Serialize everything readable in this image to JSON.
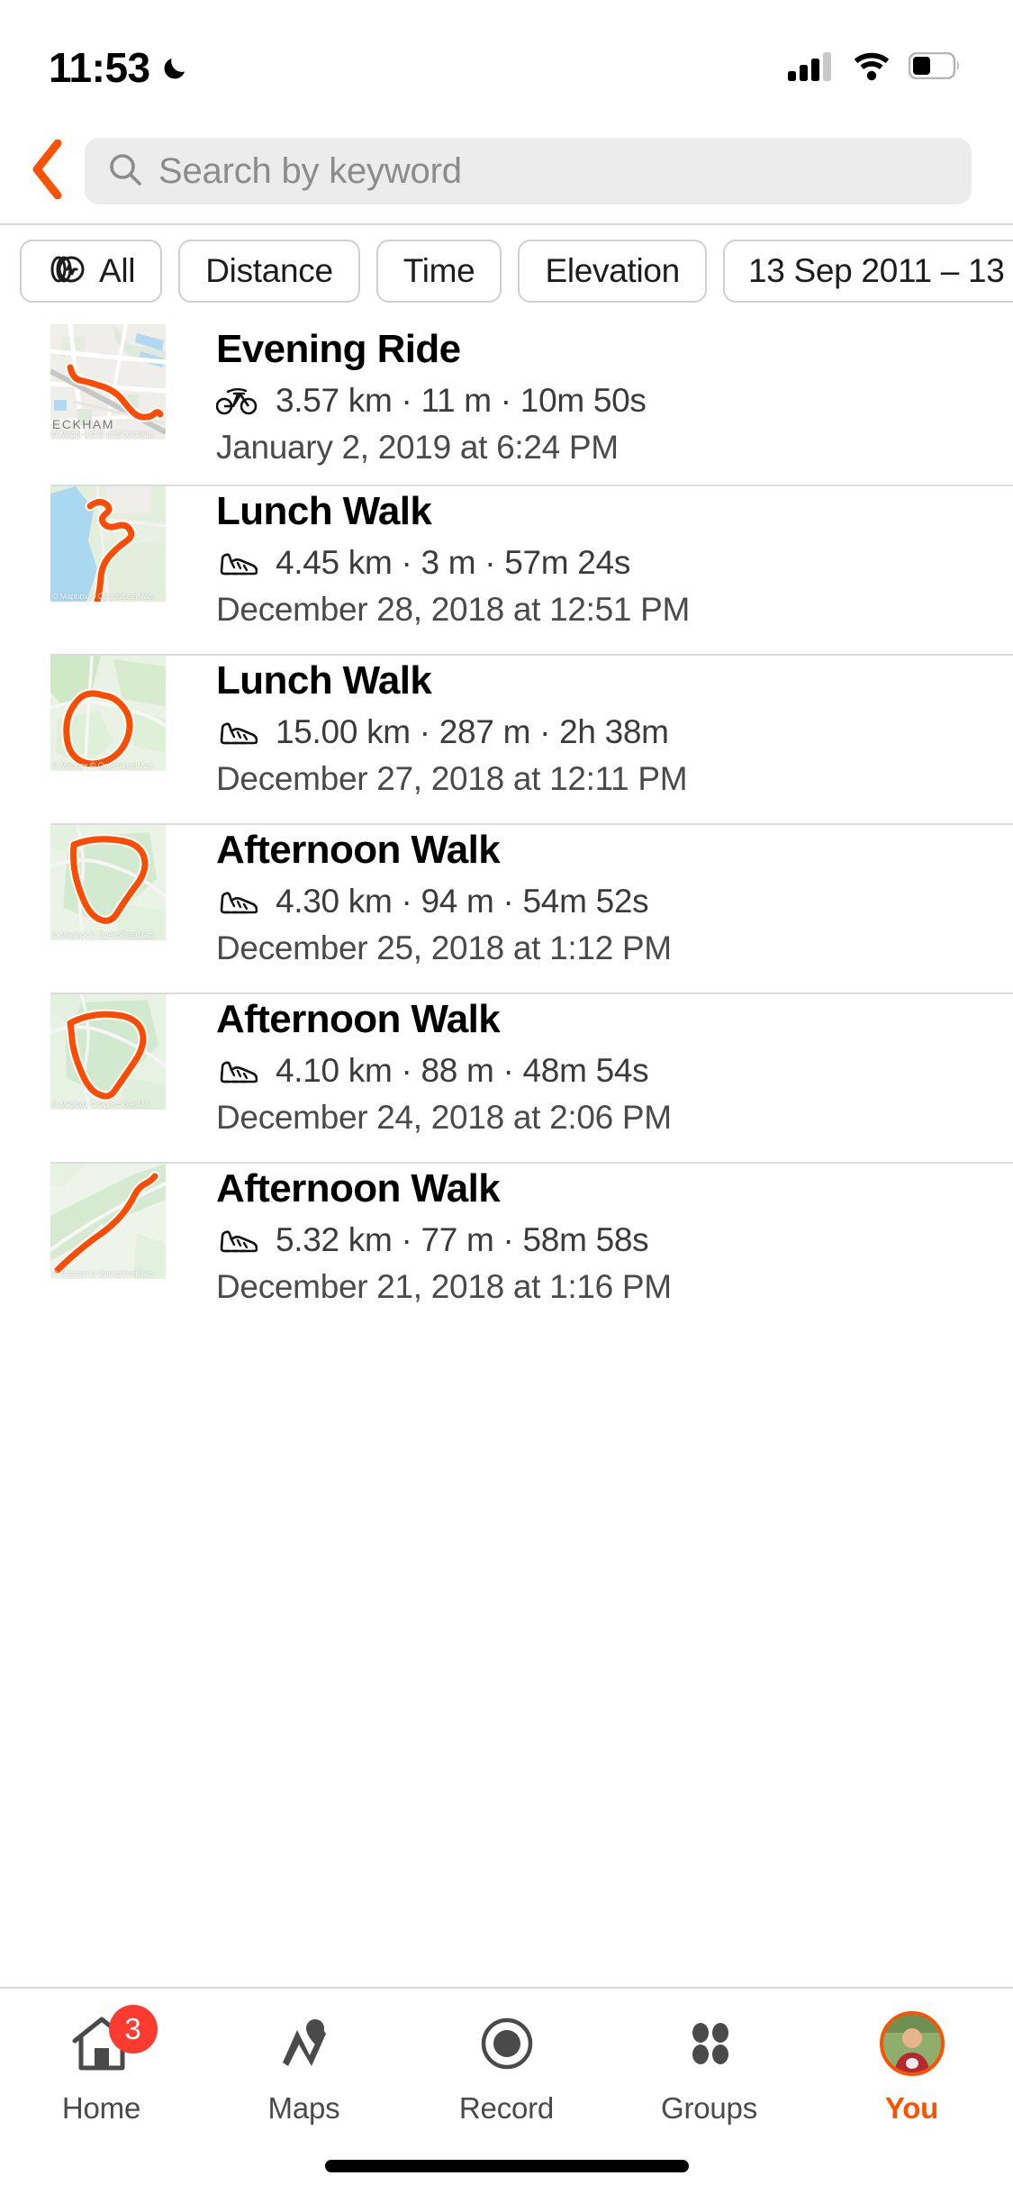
{
  "status_bar": {
    "time": "11:53",
    "moon_icon": "crescent-moon-icon",
    "cellular_icon": "cellular-signal-icon",
    "wifi_icon": "wifi-icon",
    "battery_icon": "battery-icon"
  },
  "header": {
    "back_icon": "chevron-left-icon",
    "search_icon": "search-icon",
    "search_value": "",
    "search_placeholder": "Search by keyword"
  },
  "filters": {
    "chips": [
      {
        "label": "All",
        "icon": "activity-type-icon",
        "has_icon": true
      },
      {
        "label": "Distance",
        "icon": "",
        "has_icon": false
      },
      {
        "label": "Time",
        "icon": "",
        "has_icon": false
      },
      {
        "label": "Elevation",
        "icon": "",
        "has_icon": false
      },
      {
        "label": "13 Sep 2011 – 13",
        "icon": "",
        "has_icon": false
      }
    ]
  },
  "activities": [
    {
      "title": "Evening Ride",
      "sport_icon": "bicycle-icon",
      "stats": "3.57 km · 11 m · 10m 50s",
      "distance": "3.57 km",
      "elevation": "11 m",
      "duration": "10m 50s",
      "date": "January 2, 2019 at 6:24 PM",
      "map_label": "ECKHAM",
      "map_attribution": "© Mapbox © OpenStreetMap"
    },
    {
      "title": "Lunch Walk",
      "sport_icon": "shoe-icon",
      "stats": "4.45 km · 3 m · 57m 24s",
      "distance": "4.45 km",
      "elevation": "3 m",
      "duration": "57m 24s",
      "date": "December 28, 2018 at 12:51 PM",
      "map_label": "",
      "map_attribution": "© Mapbox © OpenStreetMap"
    },
    {
      "title": "Lunch Walk",
      "sport_icon": "shoe-icon",
      "stats": "15.00 km · 287 m · 2h 38m",
      "distance": "15.00 km",
      "elevation": "287 m",
      "duration": "2h 38m",
      "date": "December 27, 2018 at 12:11 PM",
      "map_label": "",
      "map_attribution": "© Mapbox © OpenStreetMap"
    },
    {
      "title": "Afternoon Walk",
      "sport_icon": "shoe-icon",
      "stats": "4.30 km · 94 m · 54m 52s",
      "distance": "4.30 km",
      "elevation": "94 m",
      "duration": "54m 52s",
      "date": "December 25, 2018 at 1:12 PM",
      "map_label": "",
      "map_attribution": "© Mapbox © OpenStreetMap"
    },
    {
      "title": "Afternoon Walk",
      "sport_icon": "shoe-icon",
      "stats": "4.10 km · 88 m · 48m 54s",
      "distance": "4.10 km",
      "elevation": "88 m",
      "duration": "48m 54s",
      "date": "December 24, 2018 at 2:06 PM",
      "map_label": "",
      "map_attribution": "© Mapbox © OpenStreetMa"
    },
    {
      "title": "Afternoon Walk",
      "sport_icon": "shoe-icon",
      "stats": "5.32 km · 77 m · 58m 58s",
      "distance": "5.32 km",
      "elevation": "77 m",
      "duration": "58m 58s",
      "date": "December 21, 2018 at 1:16 PM",
      "map_label": "",
      "map_attribution": "© Mapbox © OpenStreetMap"
    }
  ],
  "tabbar": {
    "items": [
      {
        "label": "Home",
        "icon": "home-icon",
        "badge": "3",
        "active": false
      },
      {
        "label": "Maps",
        "icon": "maps-pin-icon",
        "badge": "",
        "active": false
      },
      {
        "label": "Record",
        "icon": "record-circle-icon",
        "badge": "",
        "active": false
      },
      {
        "label": "Groups",
        "icon": "groups-dots-icon",
        "badge": "",
        "active": false
      },
      {
        "label": "You",
        "icon": "avatar-icon",
        "badge": "",
        "active": true
      }
    ]
  },
  "colors": {
    "brand_orange": "#fc5200",
    "route_orange": "#fc4c02",
    "badge_red": "#fc3b30",
    "search_bg": "#ececec",
    "divider": "#dcdcdc"
  }
}
